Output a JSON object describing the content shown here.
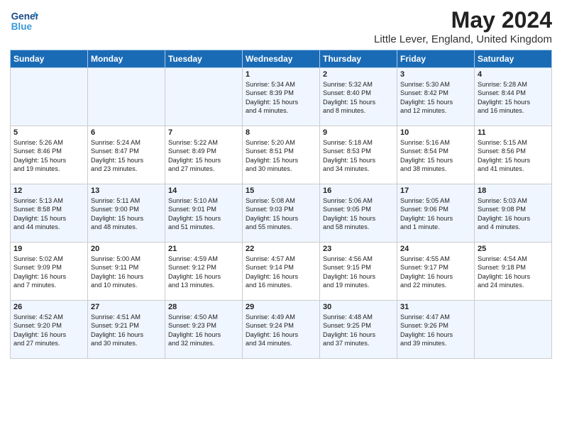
{
  "header": {
    "logo_general": "General",
    "logo_blue": "Blue",
    "title": "May 2024",
    "subtitle": "Little Lever, England, United Kingdom"
  },
  "days_of_week": [
    "Sunday",
    "Monday",
    "Tuesday",
    "Wednesday",
    "Thursday",
    "Friday",
    "Saturday"
  ],
  "weeks": [
    {
      "cells": [
        {
          "day": "",
          "info": ""
        },
        {
          "day": "",
          "info": ""
        },
        {
          "day": "",
          "info": ""
        },
        {
          "day": "1",
          "info": "Sunrise: 5:34 AM\nSunset: 8:39 PM\nDaylight: 15 hours\nand 4 minutes."
        },
        {
          "day": "2",
          "info": "Sunrise: 5:32 AM\nSunset: 8:40 PM\nDaylight: 15 hours\nand 8 minutes."
        },
        {
          "day": "3",
          "info": "Sunrise: 5:30 AM\nSunset: 8:42 PM\nDaylight: 15 hours\nand 12 minutes."
        },
        {
          "day": "4",
          "info": "Sunrise: 5:28 AM\nSunset: 8:44 PM\nDaylight: 15 hours\nand 16 minutes."
        }
      ]
    },
    {
      "cells": [
        {
          "day": "5",
          "info": "Sunrise: 5:26 AM\nSunset: 8:46 PM\nDaylight: 15 hours\nand 19 minutes."
        },
        {
          "day": "6",
          "info": "Sunrise: 5:24 AM\nSunset: 8:47 PM\nDaylight: 15 hours\nand 23 minutes."
        },
        {
          "day": "7",
          "info": "Sunrise: 5:22 AM\nSunset: 8:49 PM\nDaylight: 15 hours\nand 27 minutes."
        },
        {
          "day": "8",
          "info": "Sunrise: 5:20 AM\nSunset: 8:51 PM\nDaylight: 15 hours\nand 30 minutes."
        },
        {
          "day": "9",
          "info": "Sunrise: 5:18 AM\nSunset: 8:53 PM\nDaylight: 15 hours\nand 34 minutes."
        },
        {
          "day": "10",
          "info": "Sunrise: 5:16 AM\nSunset: 8:54 PM\nDaylight: 15 hours\nand 38 minutes."
        },
        {
          "day": "11",
          "info": "Sunrise: 5:15 AM\nSunset: 8:56 PM\nDaylight: 15 hours\nand 41 minutes."
        }
      ]
    },
    {
      "cells": [
        {
          "day": "12",
          "info": "Sunrise: 5:13 AM\nSunset: 8:58 PM\nDaylight: 15 hours\nand 44 minutes."
        },
        {
          "day": "13",
          "info": "Sunrise: 5:11 AM\nSunset: 9:00 PM\nDaylight: 15 hours\nand 48 minutes."
        },
        {
          "day": "14",
          "info": "Sunrise: 5:10 AM\nSunset: 9:01 PM\nDaylight: 15 hours\nand 51 minutes."
        },
        {
          "day": "15",
          "info": "Sunrise: 5:08 AM\nSunset: 9:03 PM\nDaylight: 15 hours\nand 55 minutes."
        },
        {
          "day": "16",
          "info": "Sunrise: 5:06 AM\nSunset: 9:05 PM\nDaylight: 15 hours\nand 58 minutes."
        },
        {
          "day": "17",
          "info": "Sunrise: 5:05 AM\nSunset: 9:06 PM\nDaylight: 16 hours\nand 1 minute."
        },
        {
          "day": "18",
          "info": "Sunrise: 5:03 AM\nSunset: 9:08 PM\nDaylight: 16 hours\nand 4 minutes."
        }
      ]
    },
    {
      "cells": [
        {
          "day": "19",
          "info": "Sunrise: 5:02 AM\nSunset: 9:09 PM\nDaylight: 16 hours\nand 7 minutes."
        },
        {
          "day": "20",
          "info": "Sunrise: 5:00 AM\nSunset: 9:11 PM\nDaylight: 16 hours\nand 10 minutes."
        },
        {
          "day": "21",
          "info": "Sunrise: 4:59 AM\nSunset: 9:12 PM\nDaylight: 16 hours\nand 13 minutes."
        },
        {
          "day": "22",
          "info": "Sunrise: 4:57 AM\nSunset: 9:14 PM\nDaylight: 16 hours\nand 16 minutes."
        },
        {
          "day": "23",
          "info": "Sunrise: 4:56 AM\nSunset: 9:15 PM\nDaylight: 16 hours\nand 19 minutes."
        },
        {
          "day": "24",
          "info": "Sunrise: 4:55 AM\nSunset: 9:17 PM\nDaylight: 16 hours\nand 22 minutes."
        },
        {
          "day": "25",
          "info": "Sunrise: 4:54 AM\nSunset: 9:18 PM\nDaylight: 16 hours\nand 24 minutes."
        }
      ]
    },
    {
      "cells": [
        {
          "day": "26",
          "info": "Sunrise: 4:52 AM\nSunset: 9:20 PM\nDaylight: 16 hours\nand 27 minutes."
        },
        {
          "day": "27",
          "info": "Sunrise: 4:51 AM\nSunset: 9:21 PM\nDaylight: 16 hours\nand 30 minutes."
        },
        {
          "day": "28",
          "info": "Sunrise: 4:50 AM\nSunset: 9:23 PM\nDaylight: 16 hours\nand 32 minutes."
        },
        {
          "day": "29",
          "info": "Sunrise: 4:49 AM\nSunset: 9:24 PM\nDaylight: 16 hours\nand 34 minutes."
        },
        {
          "day": "30",
          "info": "Sunrise: 4:48 AM\nSunset: 9:25 PM\nDaylight: 16 hours\nand 37 minutes."
        },
        {
          "day": "31",
          "info": "Sunrise: 4:47 AM\nSunset: 9:26 PM\nDaylight: 16 hours\nand 39 minutes."
        },
        {
          "day": "",
          "info": ""
        }
      ]
    }
  ]
}
